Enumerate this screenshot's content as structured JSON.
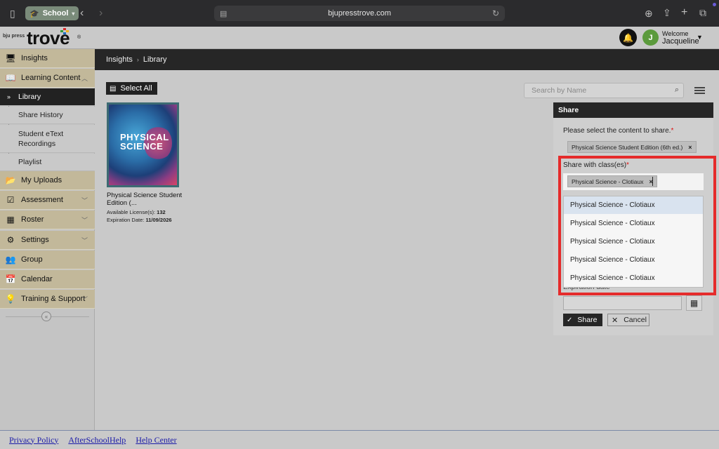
{
  "browser": {
    "tab_group_label": "School",
    "url": "bjupresstrove.com"
  },
  "header": {
    "logo_small": "bju press",
    "logo_main": "trove",
    "logo_reg": "®",
    "avatar_initial": "J",
    "welcome_label": "Welcome",
    "user_name": "Jacqueline"
  },
  "sidebar": {
    "items": [
      {
        "label": "Insights",
        "icon": "monitor-icon"
      },
      {
        "label": "Learning Content",
        "icon": "book-icon"
      },
      {
        "label": "My Uploads",
        "icon": "folder-icon"
      },
      {
        "label": "Assessment",
        "icon": "checkbox-icon"
      },
      {
        "label": "Roster",
        "icon": "calendar-grid-icon"
      },
      {
        "label": "Settings",
        "icon": "gear-icon"
      },
      {
        "label": "Group",
        "icon": "users-icon"
      },
      {
        "label": "Calendar",
        "icon": "calendar-icon"
      },
      {
        "label": "Training & Support",
        "icon": "lightbulb-icon"
      }
    ],
    "sub_items": [
      {
        "label": "Library"
      },
      {
        "label": "Share History"
      },
      {
        "label": "Student eText Recordings"
      },
      {
        "label": "Playlist"
      }
    ]
  },
  "breadcrumb": {
    "items": [
      "Insights",
      "Library"
    ]
  },
  "toolbar": {
    "select_all_label": "Select All",
    "search_placeholder": "Search by Name"
  },
  "book": {
    "cover_title": "PHYSICAL SCIENCE",
    "title": "Physical Science Student Edition (...",
    "licenses_label": "Available License(s):",
    "licenses_value": "132",
    "expiration_label": "Expiration Date:",
    "expiration_value": "11/09/2026"
  },
  "share_panel": {
    "title": "Share",
    "content_prompt": "Please select the content to share.",
    "content_chip": "Physical Science Student Edition (6th ed.)",
    "classes_label": "Share with class(es)",
    "class_chip": "Physical Science - Clotiaux",
    "dropdown_options": [
      "Physical Science - Clotiaux",
      "Physical Science - Clotiaux",
      "Physical Science - Clotiaux",
      "Physical Science - Clotiaux",
      "Physical Science - Clotiaux"
    ],
    "expiration_label": "Expiration date",
    "share_button": "Share",
    "cancel_button": "Cancel",
    "required_marker": "*",
    "chip_remove": "×"
  },
  "footer": {
    "links": [
      "Privacy Policy",
      "AfterSchoolHelp",
      "Help Center"
    ]
  },
  "colors": {
    "highlight_box": "#e52b2b",
    "nav_item_bg": "#c2b89a",
    "active_sub_bg": "#222222"
  }
}
